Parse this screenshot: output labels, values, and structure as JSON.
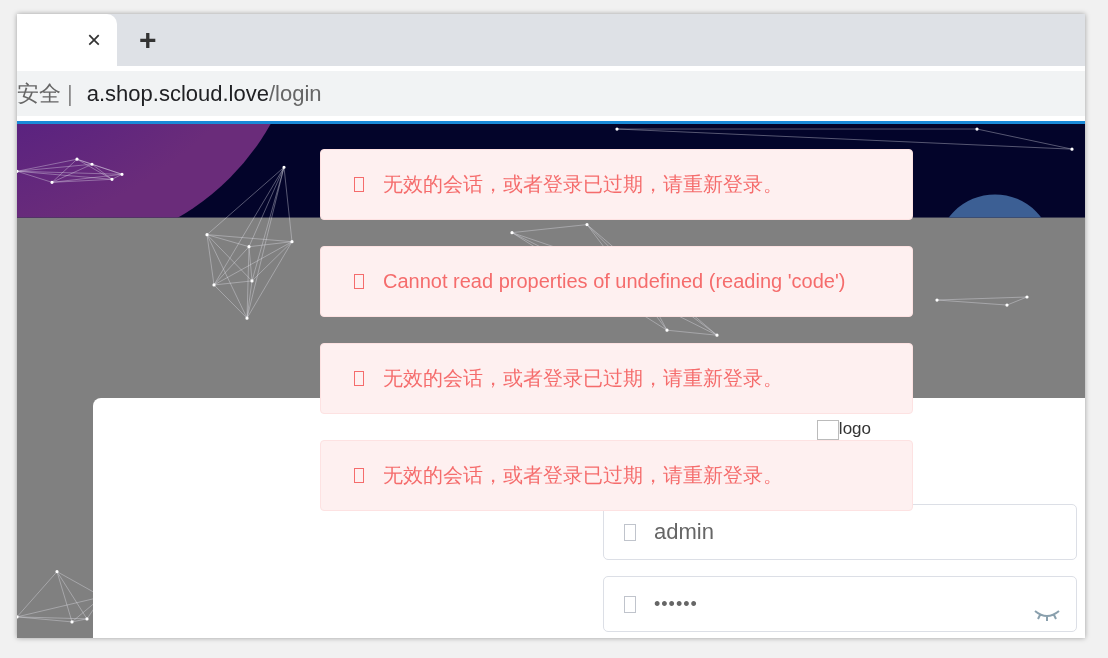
{
  "browser": {
    "tab": {
      "close": "×"
    },
    "new_tab": "+",
    "address": {
      "security": "安全",
      "separator": "|",
      "host": "a.shop.scloud.love",
      "path": "/login"
    }
  },
  "toasts": [
    {
      "message": "无效的会话，或者登录已过期，请重新登录。"
    },
    {
      "message": "Cannot read properties of undefined (reading 'code')"
    },
    {
      "message": "无效的会话，或者登录已过期，请重新登录。"
    },
    {
      "message": "无效的会话，或者登录已过期，请重新登录。"
    }
  ],
  "login": {
    "logo_alt": "logo",
    "fields": [
      {
        "kind": "text",
        "value": "admin"
      },
      {
        "kind": "password",
        "value": "••••••"
      }
    ]
  }
}
